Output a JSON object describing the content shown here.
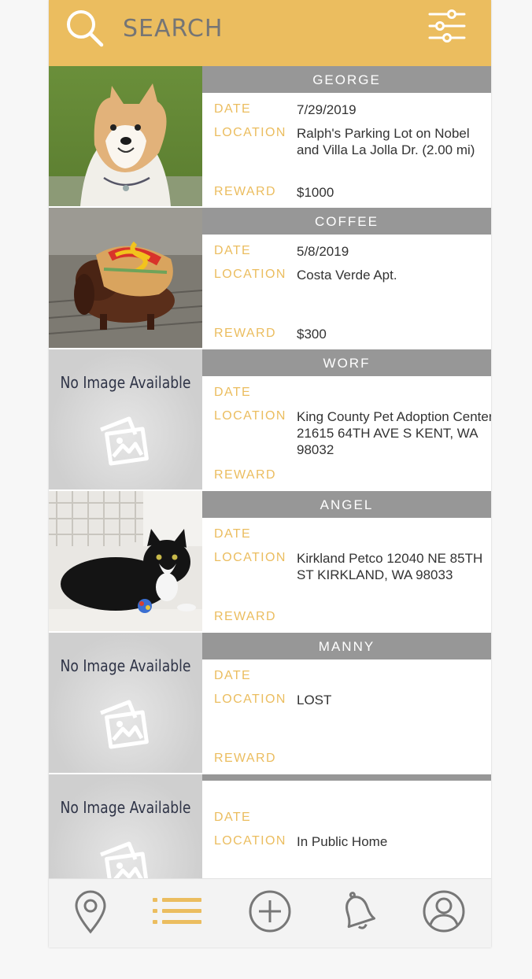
{
  "search": {
    "placeholder": "SEARCH",
    "value": ""
  },
  "colors": {
    "accent": "#ebbd5f",
    "header_gray": "#979797",
    "label": "#ebbd5f"
  },
  "labels": {
    "date": "DATE",
    "location": "LOCATION",
    "reward": "REWARD"
  },
  "no_image_text": "No Image Available",
  "pets": [
    {
      "name": "GEORGE",
      "date": "7/29/2019",
      "location": "Ralph's Parking Lot on Nobel and Villa La Jolla Dr. (2.00 mi)",
      "reward": "$1000",
      "image": "shiba-dog-photo"
    },
    {
      "name": "COFFEE",
      "date": "5/8/2019",
      "location": "Costa Verde Apt.",
      "reward": "$300",
      "image": "dachshund-hotdog-photo"
    },
    {
      "name": "WORF",
      "date": "",
      "location": "King County Pet Adoption Center 21615 64TH AVE S KENT, WA 98032",
      "reward": "",
      "image": "no-image"
    },
    {
      "name": "ANGEL",
      "date": "",
      "location": "Kirkland Petco 12040 NE 85TH ST KIRKLAND, WA 98033",
      "reward": "",
      "image": "tuxedo-cat-photo"
    },
    {
      "name": "MANNY",
      "date": "",
      "location": "LOST",
      "reward": "",
      "image": "no-image"
    },
    {
      "name": "",
      "date": "",
      "location": "In Public Home",
      "reward": "",
      "image": "no-image"
    }
  ],
  "nav": [
    {
      "icon": "map-pin-icon",
      "active": false
    },
    {
      "icon": "list-icon",
      "active": true
    },
    {
      "icon": "add-circle-icon",
      "active": false
    },
    {
      "icon": "bell-icon",
      "active": false
    },
    {
      "icon": "profile-icon",
      "active": false
    }
  ]
}
